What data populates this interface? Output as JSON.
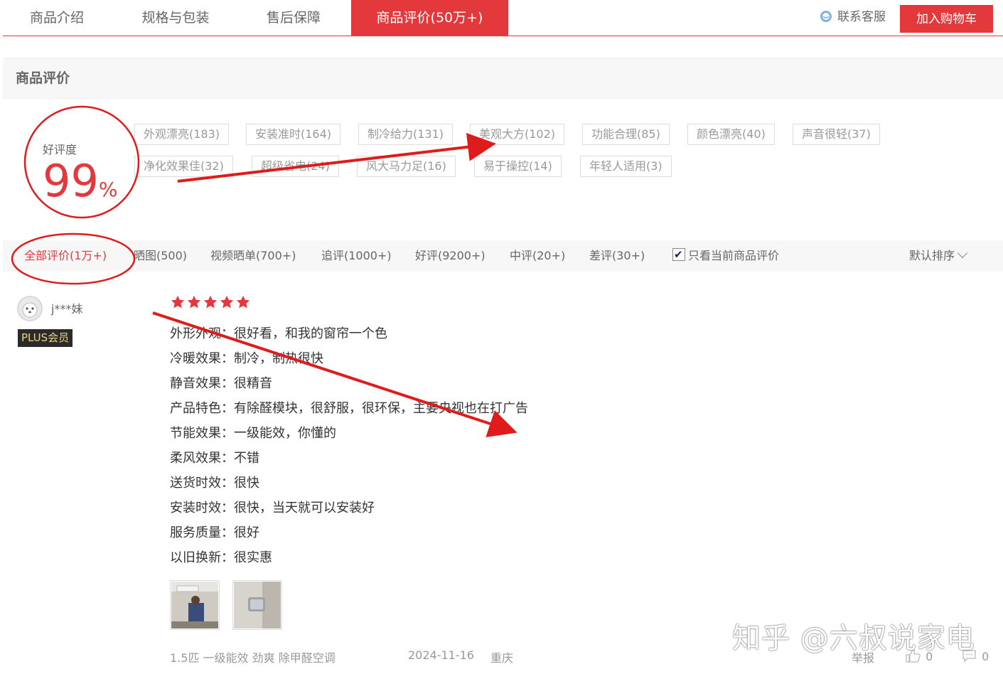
{
  "tabs": [
    {
      "label": "商品介绍",
      "active": false
    },
    {
      "label": "规格与包装",
      "active": false
    },
    {
      "label": "售后保障",
      "active": false
    },
    {
      "label": "商品评价(50万+)",
      "active": true
    }
  ],
  "header": {
    "service_label": "联系客服",
    "cart_label": "加入购物车"
  },
  "section": {
    "title": "商品评价"
  },
  "rating": {
    "label": "好评度",
    "value": "99",
    "unit": "%"
  },
  "tags": [
    "外观漂亮(183)",
    "安装准时(164)",
    "制冷给力(131)",
    "美观大方(102)",
    "功能合理(85)",
    "颜色漂亮(40)",
    "声音很轻(37)",
    "净化效果佳(32)",
    "超级省电(24)",
    "风大马力足(16)",
    "易于操控(14)",
    "年轻人适用(3)"
  ],
  "filters": [
    "全部评价(1万+)",
    "晒图(500)",
    "视频晒单(700+)",
    "追评(1000+)",
    "好评(9200+)",
    "中评(20+)",
    "差评(30+)"
  ],
  "only_current_label": "只看当前商品评价",
  "sort_label": "默认排序",
  "review": {
    "username": "j***妹",
    "badge": "PLUS会员",
    "stars": 5,
    "lines": [
      "外形外观：很好看，和我的窗帘一个色",
      "冷暖效果：制冷，制热很快",
      "静音效果：很精音",
      "产品特色：有除醛模块，很舒服，很环保，主要央视也在打广告",
      "节能效果：一级能效，你懂的",
      "柔风效果：不错",
      "送货时效：很快",
      "安装时效：很快，当天就可以安装好",
      "服务质量：很好",
      "以旧换新：很实惠"
    ],
    "product": "1.5匹 一级能效 劲爽 除甲醛空调",
    "date": "2024-11-16",
    "location": "重庆",
    "report_label": "举报",
    "like_count": "0",
    "comment_count": "0"
  },
  "watermark": "知乎 @六叔说家电",
  "colors": {
    "accent": "#e4393c",
    "plus_gold": "#f2d27a"
  }
}
